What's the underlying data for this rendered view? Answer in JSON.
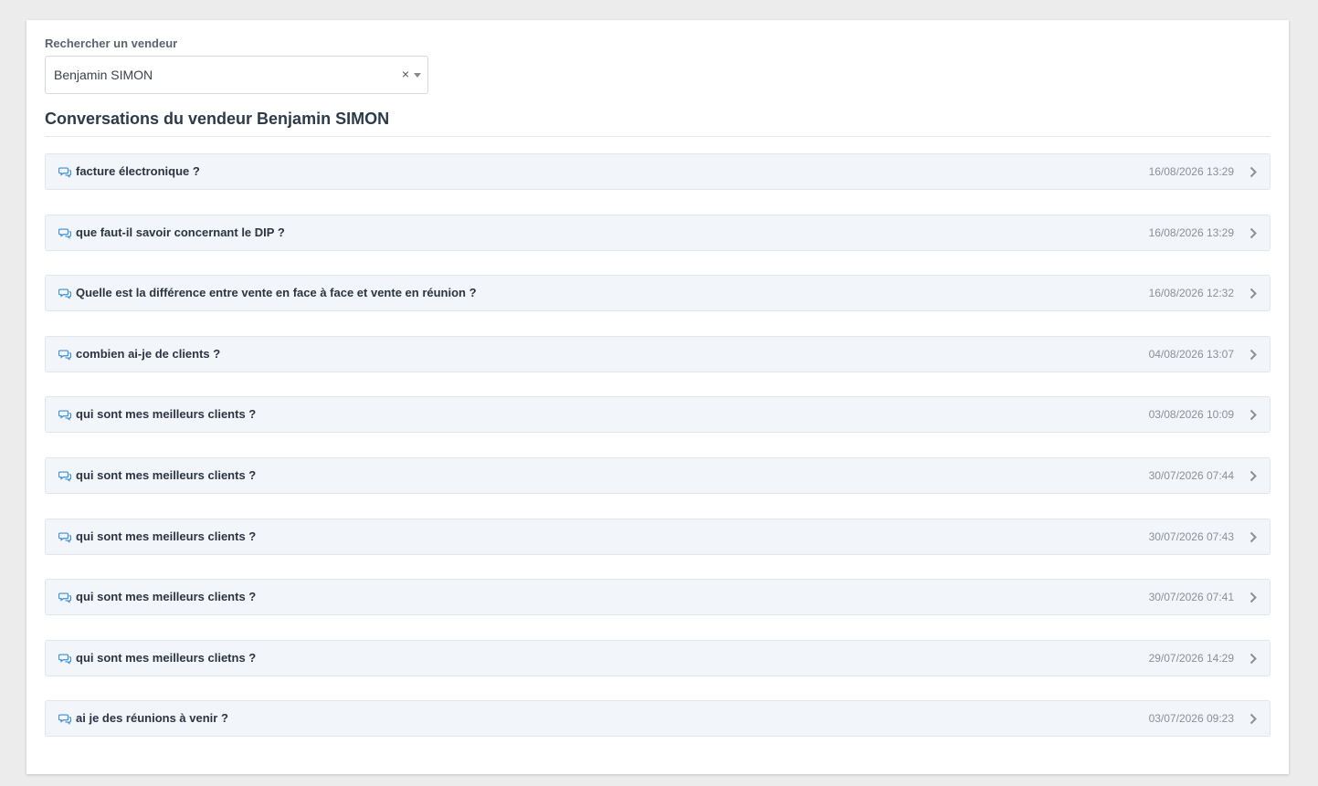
{
  "search": {
    "label": "Rechercher un vendeur",
    "selected_value": "Benjamin SIMON",
    "clear_symbol": "×"
  },
  "page_title": "Conversations du vendeur Benjamin SIMON",
  "colors": {
    "accent_icon": "#3b8fd9",
    "row_background": "#f2f5f9",
    "row_border": "#e1e6ec",
    "date_text": "#8a9099"
  },
  "icons": {
    "conversation": "comments-icon",
    "open": "chevron-right-icon"
  },
  "conversations": [
    {
      "title": "facture électronique ?",
      "date": "16/08/2026 13:29"
    },
    {
      "title": "que faut-il savoir concernant le DIP ?",
      "date": "16/08/2026 13:29"
    },
    {
      "title": "Quelle est la différence entre vente en face à face et vente en réunion ?",
      "date": "16/08/2026 12:32"
    },
    {
      "title": "combien ai-je de clients ?",
      "date": "04/08/2026 13:07"
    },
    {
      "title": "qui sont mes meilleurs clients ?",
      "date": "03/08/2026 10:09"
    },
    {
      "title": "qui sont mes meilleurs clients ?",
      "date": "30/07/2026 07:44"
    },
    {
      "title": "qui sont mes meilleurs clients ?",
      "date": "30/07/2026 07:43"
    },
    {
      "title": "qui sont mes meilleurs clients ?",
      "date": "30/07/2026 07:41"
    },
    {
      "title": "qui sont mes meilleurs clietns ?",
      "date": "29/07/2026 14:29"
    },
    {
      "title": "ai je des réunions à venir ?",
      "date": "03/07/2026 09:23"
    }
  ]
}
